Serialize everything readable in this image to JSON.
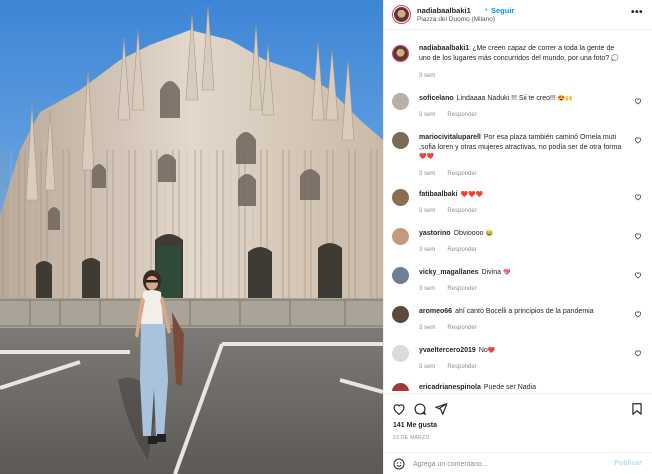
{
  "post": {
    "username": "nadiabaalbaki1",
    "separator": "•",
    "follow_label": "Seguir",
    "location": "Piazza del Duomo (Milano)",
    "more_label": "•••"
  },
  "caption": {
    "username": "nadiabaalbaki1",
    "text": "¿Me creen capaz de correr a toda la gente de uno de los lugares más concurridos del mundo, por una foto?",
    "time": "3 sem"
  },
  "comments": [
    {
      "username": "soficelano",
      "text": "Lindaaaa Naduki !!! Sii te creo!!!",
      "emoji": "😍🙌",
      "time": "3 sem",
      "reply": "Responder"
    },
    {
      "username": "mariocivitaluparell",
      "text": "Por esa plaza también caminó Ornela muti ,sofia loren y otras mujeres atractivas, no podía ser de otra forma",
      "emoji": "❤️❤️",
      "time": "3 sem",
      "reply": "Responder"
    },
    {
      "username": "fatibaalbaki",
      "text": "",
      "emoji": "❤️❤️❤️",
      "time": "3 sem",
      "reply": "Responder"
    },
    {
      "username": "yastorino",
      "text": "Obvioooo",
      "emoji": "😂",
      "time": "3 sem",
      "reply": "Responder"
    },
    {
      "username": "vicky_magallanes",
      "text": "Divina",
      "emoji": "💖",
      "time": "3 sem",
      "reply": "Responder"
    },
    {
      "username": "aromeo66",
      "text": "ahí cantó Bocelli a principios de la pandemia",
      "emoji": "",
      "time": "3 sem",
      "reply": "Responder"
    },
    {
      "username": "yvaeltercero2019",
      "text": "No",
      "emoji": "❤️",
      "time": "3 sem",
      "reply": "Responder"
    },
    {
      "username": "ericadrianespinola",
      "text": "Puede ser Nadia",
      "emoji": "",
      "time": "",
      "reply": ""
    }
  ],
  "stats": {
    "likes": "141 Me gusta",
    "date": "23 DE MARZO"
  },
  "add_comment": {
    "placeholder": "Agrega un comentario...",
    "post_label": "Publicar"
  },
  "colors": {
    "accent": "#0095f6",
    "heart": "#ed4956",
    "muted": "#8e8e8e",
    "sky": "#4d92d8"
  },
  "icons": [
    "heart-icon",
    "comment-icon",
    "share-icon",
    "bookmark-icon",
    "emoji-icon",
    "more-icon"
  ]
}
